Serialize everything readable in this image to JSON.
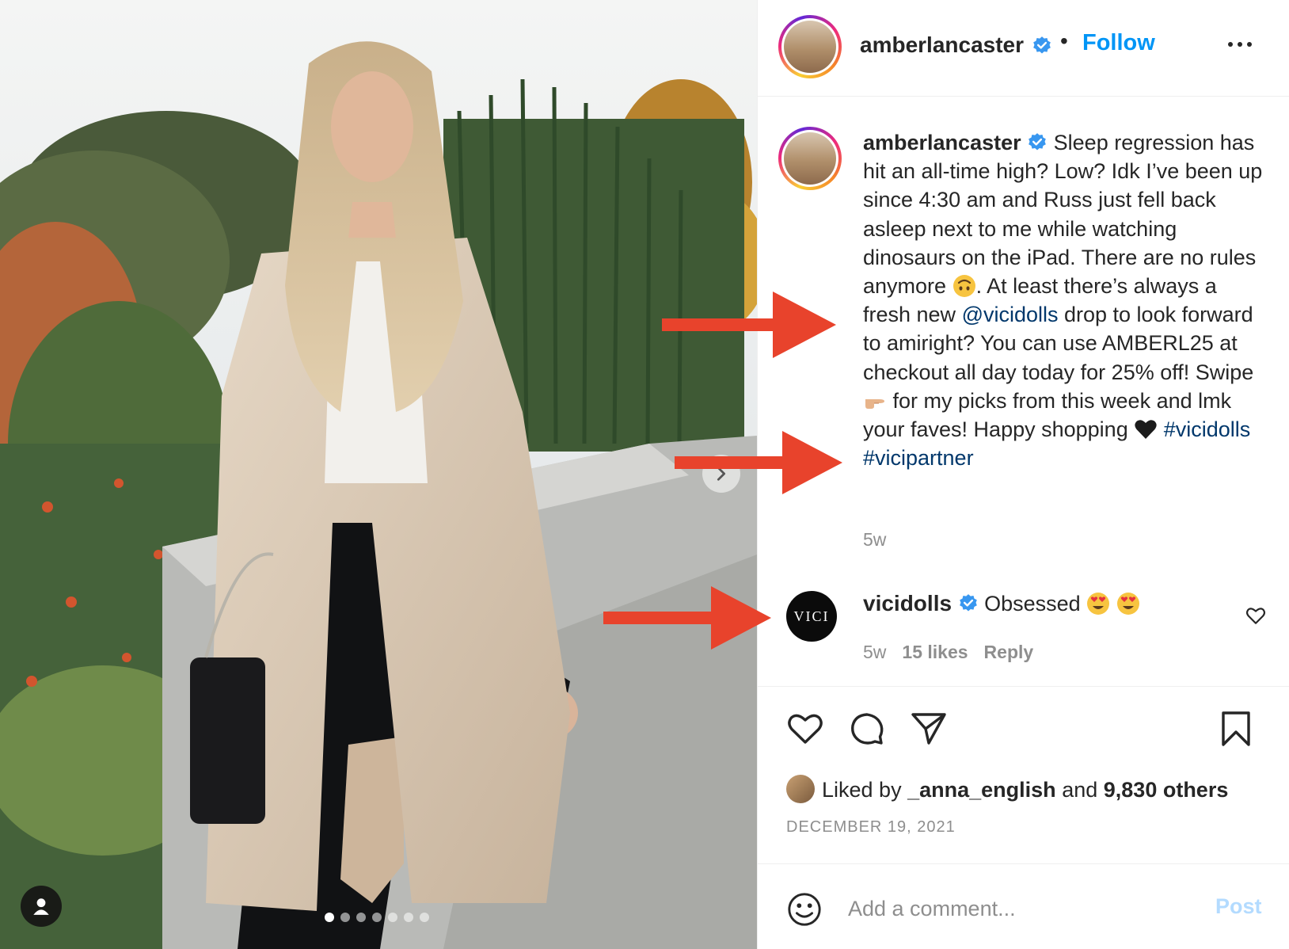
{
  "post": {
    "username": "amberlancaster",
    "follow_label": "Follow",
    "separator": "•",
    "caption_parts": {
      "p1": "Sleep regression has hit an all-time high? Low? Idk I’ve been up since 4:30 am and Russ just fell back asleep next to me while watching dinosaurs on the iPad. There are no rules anymore ",
      "p2": ". At least there’s always a fresh new ",
      "mention": "@vicidolls",
      "p3": " drop to look forward to amiright? You can use AMBERL25 at checkout all day today for 25% off! Swipe ",
      "p4": " for my picks from this week and lmk your faves! Happy shopping ",
      "hashtag1": "#vicidolls",
      "hashtag2": "#vicipartner"
    },
    "caption_time": "5w",
    "comment": {
      "avatar_text": "VICI",
      "username": "vicidolls",
      "text": "Obsessed",
      "time": "5w",
      "likes": "15 likes",
      "reply_label": "Reply"
    },
    "liked_by": {
      "prefix": "Liked by",
      "user": "_anna_english",
      "and": "and",
      "others": "9,830 others"
    },
    "date": "DECEMBER 19, 2021",
    "add_comment_placeholder": "Add a comment...",
    "post_label": "Post",
    "carousel": {
      "count": 7,
      "active_index": 0
    }
  },
  "icons": {
    "verified": "verified-badge-icon",
    "more": "more-options-icon",
    "like": "heart-icon",
    "comment": "comment-bubble-icon",
    "share": "paper-plane-icon",
    "save": "bookmark-icon",
    "emoji": "smiley-icon",
    "next": "chevron-right-icon",
    "tags": "user-tag-icon"
  },
  "colors": {
    "link_blue": "#0095f6",
    "mention_blue": "#00376b",
    "verified_blue": "#3897f0",
    "arrow_red": "#e8432c",
    "muted": "#8e8e8e"
  }
}
